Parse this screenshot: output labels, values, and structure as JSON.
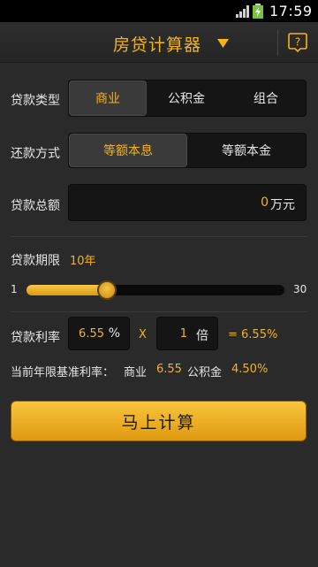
{
  "status": {
    "time": "17:59"
  },
  "header": {
    "title": "房贷计算器"
  },
  "loan_type": {
    "label": "贷款类型",
    "options": [
      "商业",
      "公积金",
      "组合"
    ],
    "selected": "商业"
  },
  "repay_method": {
    "label": "还款方式",
    "options": [
      "等额本息",
      "等额本金"
    ],
    "selected": "等额本息"
  },
  "loan_amount": {
    "label": "贷款总额",
    "value": "0",
    "unit": "万元"
  },
  "loan_term": {
    "label": "贷款期限",
    "value": "10年",
    "min": "1",
    "max": "30",
    "current": 10
  },
  "rate": {
    "label": "贷款利率",
    "base_value": "6.55",
    "percent_sign": "%",
    "times_sign": "X",
    "multiplier": "1",
    "multiplier_unit": "倍",
    "result": "= 6.55%"
  },
  "base_rate": {
    "label": "当前年限基准利率：",
    "commercial_label": "商业",
    "commercial_value": "6.55",
    "fund_label": "公积金",
    "fund_value": "4.50%"
  },
  "action": {
    "calculate_label": "马上计算"
  },
  "colors": {
    "accent": "#f2b31f",
    "background": "#2a2a2a",
    "field": "#151515"
  }
}
